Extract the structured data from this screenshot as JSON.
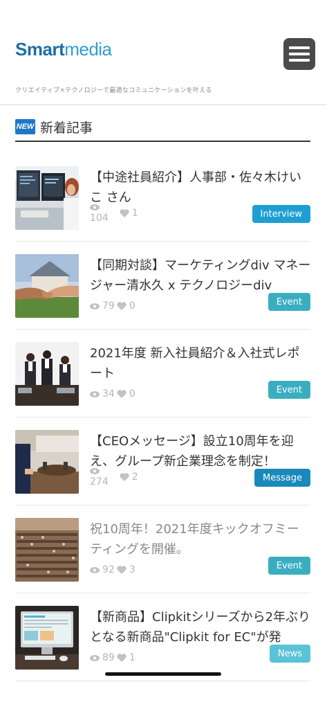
{
  "header": {
    "logo_part1": "Smart",
    "logo_part2": "media",
    "tagline": "クリエイティブ×テクノロジーで最適なコミュニケーションを叶える",
    "menu_icon": "hamburger-icon"
  },
  "section": {
    "badge": "NEW",
    "title": "新着記事"
  },
  "articles": [
    {
      "title": "【中途社員紹介】人事部・佐々木けいこ さん",
      "views": "104",
      "likes": "1",
      "tag": "Interview",
      "tag_color": "#1e9fd4"
    },
    {
      "title": "【同期対談】マーケティングdiv マネージャー清水久 x テクノロジーdiv",
      "views": "79",
      "likes": "0",
      "tag": "Event",
      "tag_color": "#3aaec0"
    },
    {
      "title": "2021年度 新入社員紹介＆入社式レポート",
      "views": "34",
      "likes": "0",
      "tag": "Event",
      "tag_color": "#3aaec0"
    },
    {
      "title": "【CEOメッセージ】設立10周年を迎え、グループ新企業理念を制定！",
      "views": "274",
      "likes": "2",
      "tag": "Message",
      "tag_color": "#1989bb"
    },
    {
      "title": "祝10周年！2021年度キックオフミーティングを開催。",
      "views": "92",
      "likes": "3",
      "tag": "Event",
      "tag_color": "#3aaec0"
    },
    {
      "title": "【新商品】Clipkitシリーズから2年ぶりとなる新商品\"Clipkit for EC\"が発",
      "views": "89",
      "likes": "1",
      "tag": "News",
      "tag_color": "#5ac3d6"
    }
  ]
}
